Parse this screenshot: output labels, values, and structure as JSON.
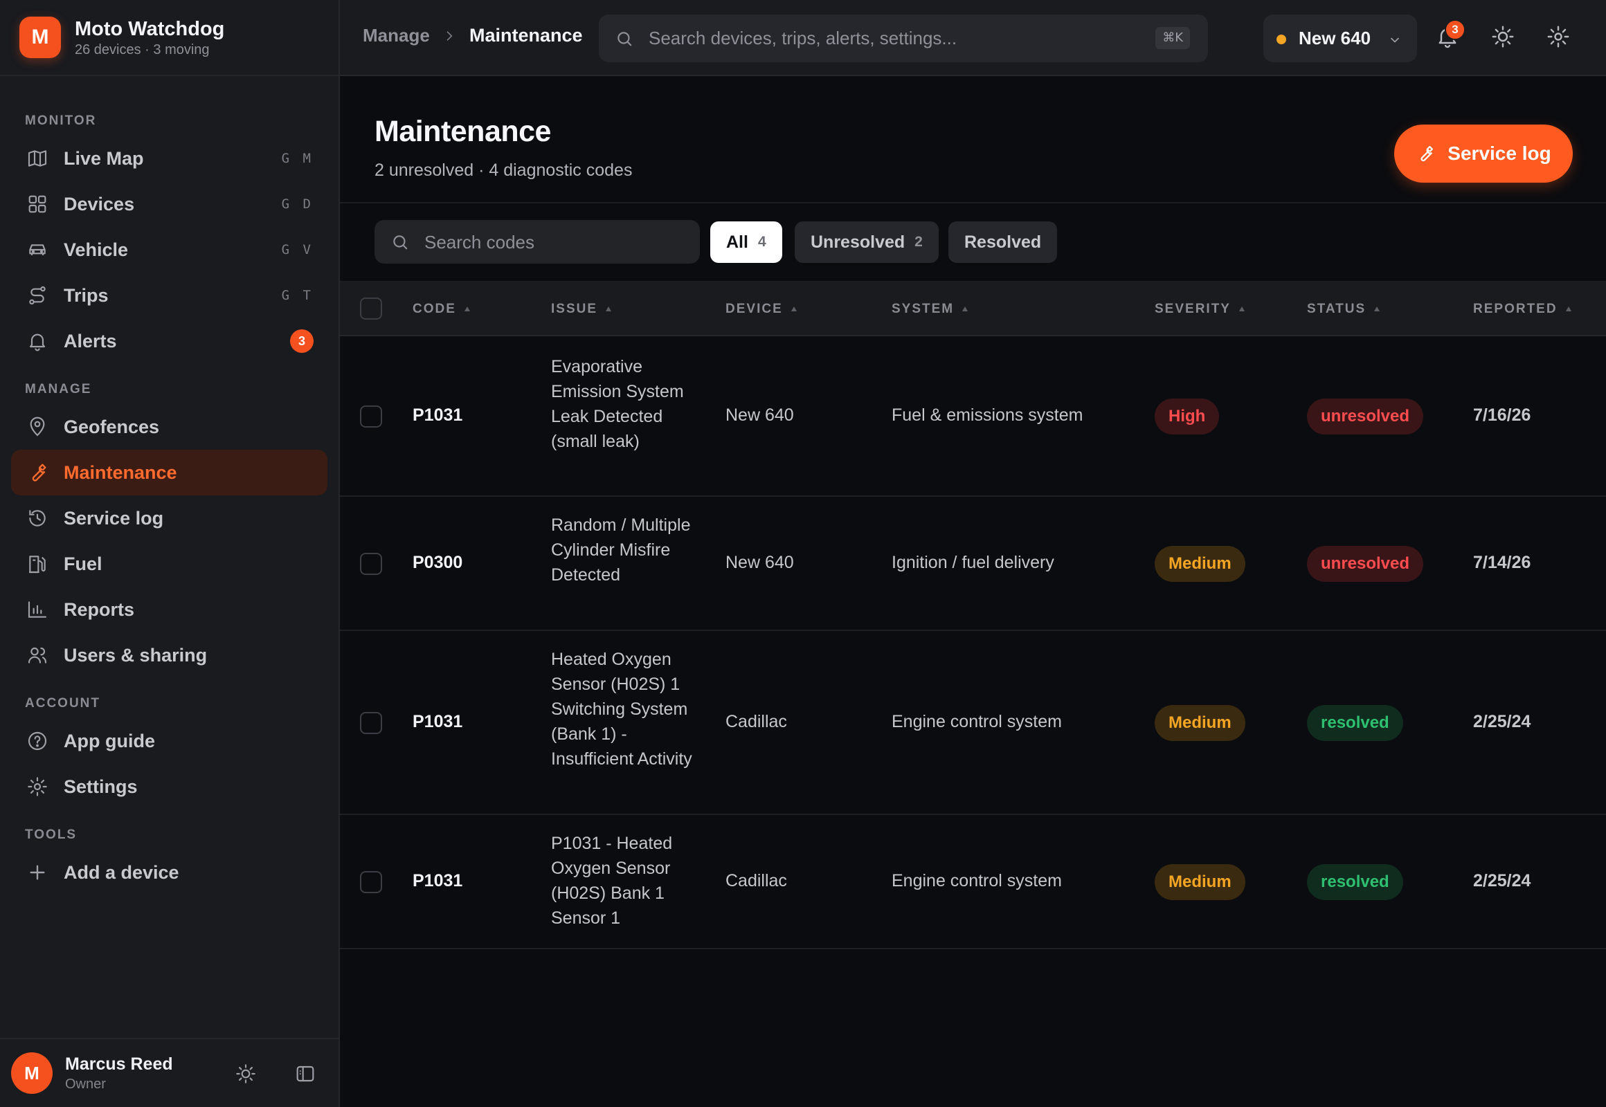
{
  "brand": {
    "logo_letter": "M",
    "title": "Moto Watchdog",
    "subtitle": "26 devices · 3 moving",
    "accent": "#f4511e"
  },
  "sidebar": {
    "sections": {
      "monitor": "MONITOR",
      "manage": "MANAGE",
      "account": "ACCOUNT",
      "tools": "TOOLS"
    },
    "monitor_items": [
      {
        "label": "Live Map",
        "shortcut": "G M",
        "icon": "map-icon"
      },
      {
        "label": "Devices",
        "shortcut": "G D",
        "icon": "grid-icon"
      },
      {
        "label": "Vehicle",
        "shortcut": "G V",
        "icon": "car-icon"
      },
      {
        "label": "Trips",
        "shortcut": "G T",
        "icon": "route-icon"
      },
      {
        "label": "Alerts",
        "badge": "3",
        "icon": "bell-icon"
      }
    ],
    "manage_items": [
      {
        "label": "Geofences",
        "icon": "pin-icon"
      },
      {
        "label": "Maintenance",
        "icon": "wrench-icon",
        "active": true
      },
      {
        "label": "Service log",
        "icon": "history-icon"
      },
      {
        "label": "Fuel",
        "icon": "fuel-icon"
      },
      {
        "label": "Reports",
        "icon": "bar-chart-icon"
      },
      {
        "label": "Users & sharing",
        "icon": "users-icon"
      }
    ],
    "account_items": [
      {
        "label": "App guide",
        "icon": "help-icon"
      },
      {
        "label": "Settings",
        "icon": "gear-icon"
      }
    ],
    "tools_items": [
      {
        "label": "Add a device",
        "icon": "plus-icon"
      }
    ]
  },
  "user": {
    "initial": "M",
    "name": "Marcus Reed",
    "role": "Owner"
  },
  "topbar": {
    "breadcrumb_parent": "Manage",
    "breadcrumb_current": "Maintenance",
    "search_placeholder": "Search devices, trips, alerts, settings...",
    "search_shortcut": "⌘K",
    "device": {
      "name": "New 640",
      "status_color": "#f5a524"
    },
    "notifications_count": "3"
  },
  "page": {
    "title": "Maintenance",
    "subtitle": "2 unresolved · 4 diagnostic codes",
    "primary_action": "Service log"
  },
  "filters": {
    "search_placeholder": "Search codes",
    "chips": [
      {
        "label": "All",
        "count": "4",
        "active": true
      },
      {
        "label": "Unresolved",
        "count": "2"
      },
      {
        "label": "Resolved",
        "count": ""
      }
    ]
  },
  "table": {
    "columns": [
      "CODE",
      "ISSUE",
      "DEVICE",
      "SYSTEM",
      "SEVERITY",
      "STATUS",
      "REPORTED"
    ],
    "rows": [
      {
        "code": "P1031",
        "issue": "Evaporative Emission System Leak Detected (small leak)",
        "device": "New 640",
        "system": "Fuel & emissions system",
        "severity": "High",
        "status": "unresolved",
        "reported": "7/16/26"
      },
      {
        "code": "P0300",
        "issue": "Random / Multiple Cylinder Misfire Detected",
        "device": "New 640",
        "system": "Ignition / fuel delivery",
        "severity": "Medium",
        "status": "unresolved",
        "reported": "7/14/26"
      },
      {
        "code": "P1031",
        "issue": "Heated Oxygen Sensor (H02S) 1 Switching System (Bank 1) - Insufficient Activity",
        "device": "Cadillac",
        "system": "Engine control system",
        "severity": "Medium",
        "status": "resolved",
        "reported": "2/25/24"
      },
      {
        "code": "P1031",
        "issue": "P1031 - Heated Oxygen Sensor (H02S) Bank 1 Sensor 1",
        "device": "Cadillac",
        "system": "Engine control system",
        "severity": "Medium",
        "status": "resolved",
        "reported": "2/25/24"
      }
    ]
  }
}
